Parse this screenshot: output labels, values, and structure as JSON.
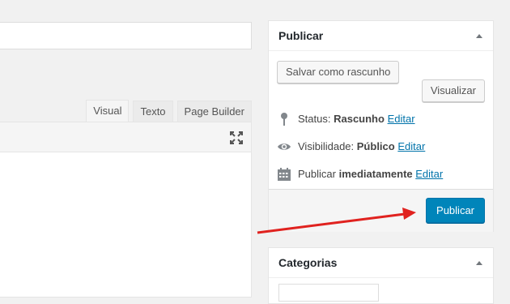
{
  "editor": {
    "tabs": [
      {
        "label": "Visual"
      },
      {
        "label": "Texto"
      },
      {
        "label": "Page Builder"
      }
    ]
  },
  "publish_box": {
    "title": "Publicar",
    "save_draft_label": "Salvar como rascunho",
    "preview_label": "Visualizar",
    "status_label": "Status:",
    "status_value": "Rascunho",
    "visibility_label": "Visibilidade:",
    "visibility_value": "Público",
    "schedule_label": "Publicar",
    "schedule_value": "imediatamente",
    "edit_link": "Editar",
    "publish_label": "Publicar"
  },
  "categories_box": {
    "title": "Categorias"
  },
  "colors": {
    "primary": "#0085ba",
    "link": "#0073aa",
    "annotation_arrow": "#e0221f"
  }
}
